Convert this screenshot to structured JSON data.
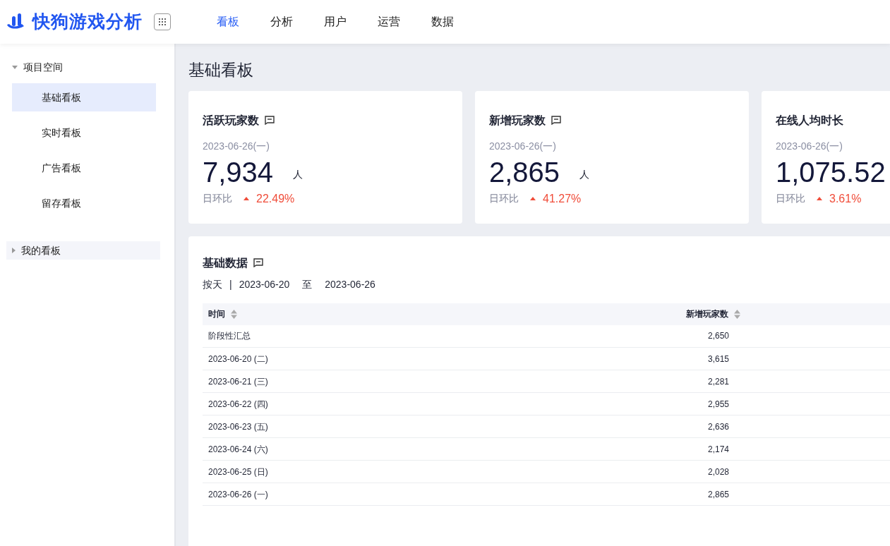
{
  "app": {
    "logo_text": "快狗游戏分析"
  },
  "nav": [
    {
      "label": "看板",
      "selected": true
    },
    {
      "label": "分析",
      "selected": false
    },
    {
      "label": "用户",
      "selected": false
    },
    {
      "label": "运营",
      "selected": false
    },
    {
      "label": "数据",
      "selected": false
    }
  ],
  "sidebar": {
    "groups": [
      {
        "label": "项目空间",
        "expanded": true,
        "children": [
          {
            "label": "基础看板",
            "selected": true
          },
          {
            "label": "实时看板",
            "selected": false
          },
          {
            "label": "广告看板",
            "selected": false
          },
          {
            "label": "留存看板",
            "selected": false
          }
        ]
      },
      {
        "label": "我的看板",
        "expanded": false
      }
    ]
  },
  "page_title": "基础看板",
  "stat_cards": [
    {
      "title": "活跃玩家数",
      "note_icon": true,
      "date": "2023-06-26(一)",
      "value": "7,934",
      "unit": "人",
      "change_label": "日环比",
      "rising": true,
      "change": "22.49%"
    },
    {
      "title": "新增玩家数",
      "note_icon": true,
      "date": "2023-06-26(一)",
      "value": "2,865",
      "unit": "人",
      "change_label": "日环比",
      "rising": true,
      "change": "41.27%"
    },
    {
      "title": "在线人均时长",
      "note_icon": false,
      "date": "2023-06-26(一)",
      "value": "1,075.52",
      "change_label": "日环比",
      "rising": true,
      "change": "3.61%"
    }
  ],
  "data_panel": {
    "title": "基础数据",
    "granularity": "按天",
    "separator": "|",
    "start_date": "2023-06-20",
    "range_word": "至",
    "end_date": "2023-06-26",
    "table": {
      "columns": [
        "时间",
        "新增玩家数"
      ],
      "rows": [
        [
          "阶段性汇总",
          "2,650"
        ],
        [
          "2023-06-20 (二)",
          "3,615"
        ],
        [
          "2023-06-21 (三)",
          "2,281"
        ],
        [
          "2023-06-22 (四)",
          "2,955"
        ],
        [
          "2023-06-23 (五)",
          "2,636"
        ],
        [
          "2023-06-24 (六)",
          "2,174"
        ],
        [
          "2023-06-25 (日)",
          "2,028"
        ],
        [
          "2023-06-26 (一)",
          "2,865"
        ]
      ]
    }
  }
}
